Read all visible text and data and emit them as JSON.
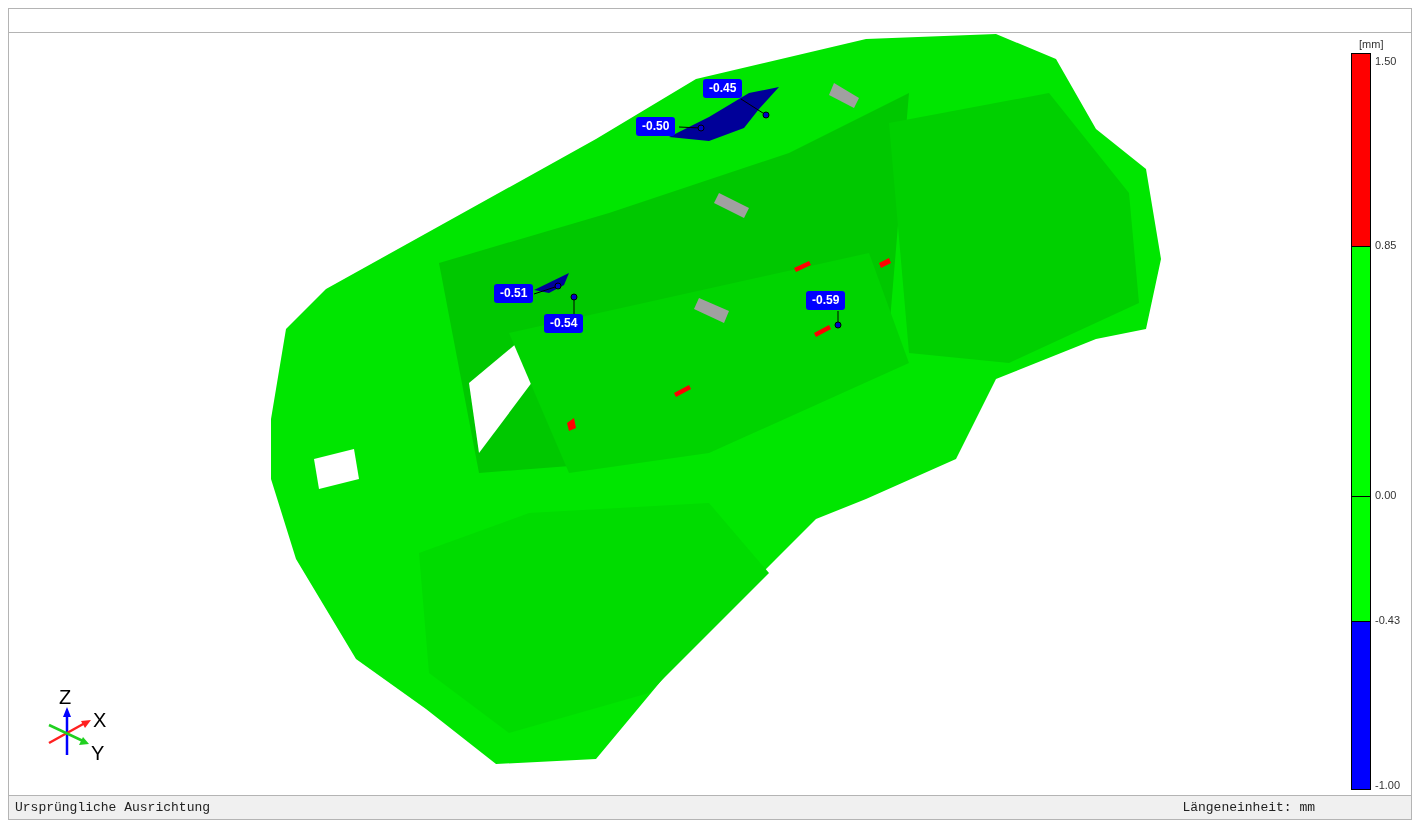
{
  "viewport": {
    "callouts": [
      {
        "value": "-0.45"
      },
      {
        "value": "-0.50"
      },
      {
        "value": "-0.51"
      },
      {
        "value": "-0.54"
      },
      {
        "value": "-0.59"
      }
    ],
    "axes": [
      {
        "label": "Z"
      },
      {
        "label": "X"
      },
      {
        "label": "Y"
      }
    ]
  },
  "legend": {
    "unit": "[mm]",
    "segments": [
      {
        "color": "#ff0000",
        "top_label": "1.50"
      },
      {
        "color": "#00ff00",
        "top_label": "0.85"
      },
      {
        "color": "#00ff00",
        "top_label": "0.00"
      },
      {
        "color": "#0000ff",
        "top_label": "-0.43"
      }
    ],
    "bottom_label": "-1.00"
  },
  "status_bar": {
    "left": "Ursprüngliche Ausrichtung",
    "right": "Längeneinheit: mm"
  }
}
